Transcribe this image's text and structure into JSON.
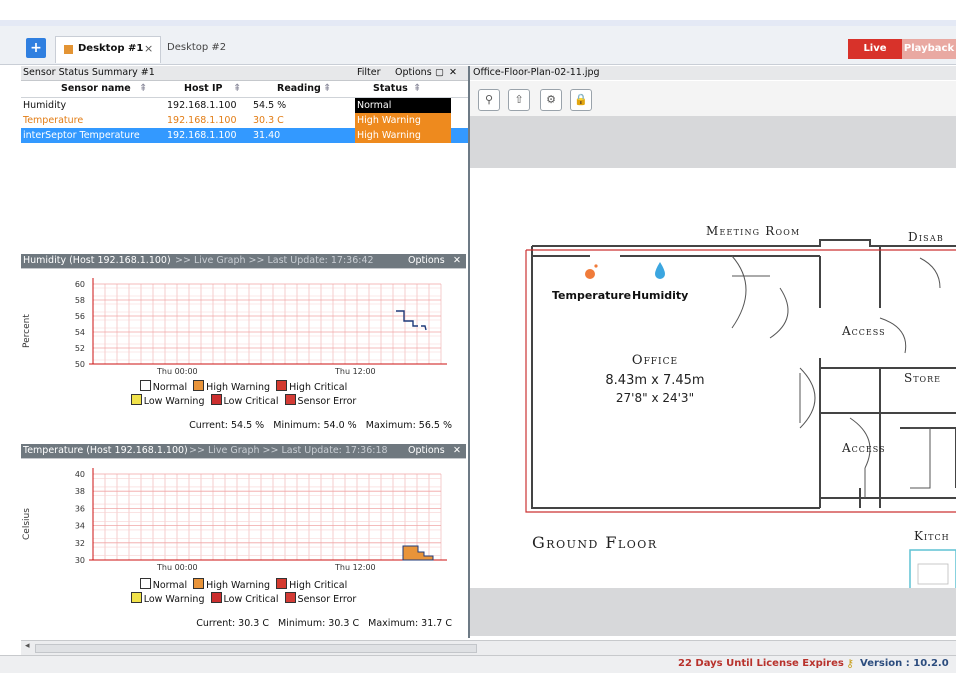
{
  "tabs": {
    "add_label": "+",
    "desktop1": "Desktop #1",
    "desktop1_close": "×",
    "desktop2": "Desktop #2"
  },
  "mode": {
    "live": "Live",
    "playback": "Playback"
  },
  "sensor_summary": {
    "title": "Sensor Status Summary #1",
    "filter": "Filter",
    "options": "Options",
    "columns": [
      "Sensor name",
      "Host IP",
      "Reading",
      "Status"
    ],
    "rows": [
      {
        "name": "Humidity",
        "ip": "192.168.1.100",
        "reading": "54.5 %",
        "status": "Normal"
      },
      {
        "name": "Temperature",
        "ip": "192.168.1.100",
        "reading": "30.3 C",
        "status": "High Warning"
      },
      {
        "name": "interSeptor Temperature",
        "ip": "192.168.1.100",
        "reading": "31.40",
        "status": "High Warning"
      }
    ]
  },
  "humidity_graph": {
    "title": "Humidity (Host 192.168.1.100)",
    "live": ">> Live Graph >> Last Update: 17:36:42",
    "options": "Options",
    "ylabel": "Percent",
    "ticks": [
      "60",
      "58",
      "56",
      "54",
      "52",
      "50"
    ],
    "xticks": [
      "Thu 00:00",
      "Thu 12:00"
    ],
    "stats": "Current: 54.5 %   Minimum: 54.0 %   Maximum: 56.5 %"
  },
  "temperature_graph": {
    "title": "Temperature (Host 192.168.1.100)",
    "live": ">> Live Graph >> Last Update: 17:36:18",
    "options": "Options",
    "ylabel": "Celsius",
    "ticks": [
      "40",
      "38",
      "36",
      "34",
      "32",
      "30"
    ],
    "xticks": [
      "Thu 00:00",
      "Thu 12:00"
    ],
    "stats": "Current: 30.3 C   Minimum: 30.3 C   Maximum: 31.7 C"
  },
  "legend": {
    "normal": "Normal",
    "high_warning": "High Warning",
    "high_critical": "High Critical",
    "low_warning": "Low Warning",
    "low_critical": "Low Critical",
    "sensor_error": "Sensor Error"
  },
  "colors": {
    "normal": "#ffffff",
    "high_warning": "#e9943a",
    "high_critical": "#d43a2f",
    "low_warning": "#f1e24a",
    "low_critical": "#cc2f2f",
    "sensor_error": "#d33b35",
    "accent": "#3399ff",
    "live": "#d8322a"
  },
  "floorplan": {
    "filename": "Office-Floor-Plan-02-11.jpg",
    "meeting_room": "Meeting Room",
    "disabled": "Disab",
    "temp_label": "Temperature",
    "hum_label": "Humidity",
    "access1": "Access",
    "access2": "Access",
    "store": "Store",
    "office": "Office",
    "office_dim1": "8.43m x 7.45m",
    "office_dim2": "27'8\" x 24'3\"",
    "ground_floor": "Ground Floor",
    "kitchen": "Kitch"
  },
  "statusbar": {
    "license": "22 Days Until License Expires",
    "version": "Version : 10.2.0"
  }
}
